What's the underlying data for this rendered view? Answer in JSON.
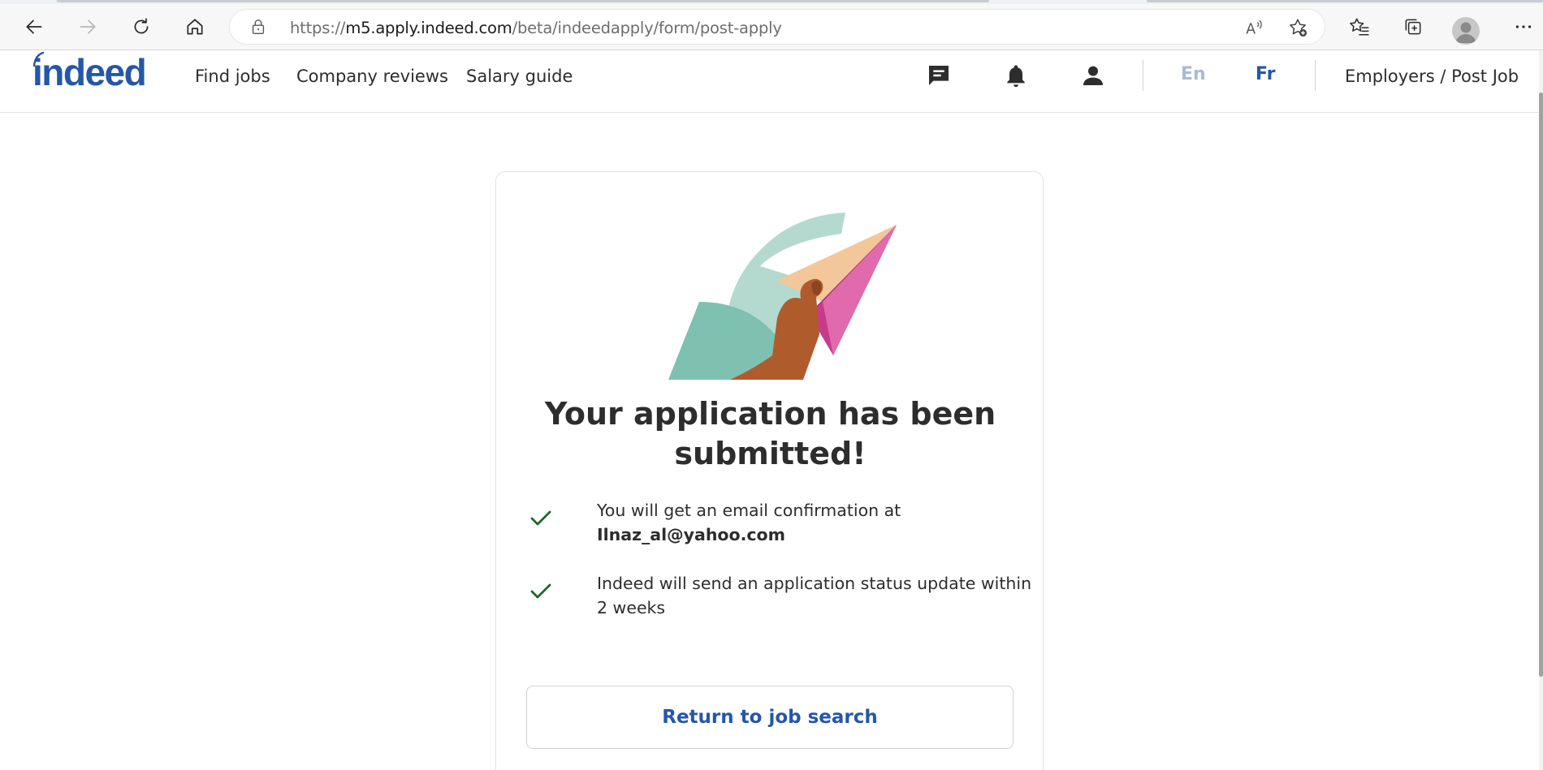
{
  "browser": {
    "url_scheme": "https://",
    "url_host": "m5.apply.indeed.com",
    "url_path": "/beta/indeedapply/form/post-apply",
    "icons": [
      "back-icon",
      "forward-icon",
      "refresh-icon",
      "home-icon",
      "lock-icon",
      "read-aloud-icon",
      "add-favorite-icon",
      "favorites-icon",
      "collections-icon",
      "profile-icon",
      "more-icon"
    ]
  },
  "header": {
    "logo": "indeed",
    "nav": [
      "Find jobs",
      "Company reviews",
      "Salary guide"
    ],
    "icons": [
      "messages-icon",
      "notifications-icon",
      "account-icon"
    ],
    "lang_en": "En",
    "lang_fr": "Fr",
    "employers": "Employers / Post Job",
    "colors": {
      "brand": "#2557a7",
      "lang_inactive": "#a7bbd8"
    }
  },
  "main": {
    "headline": "Your application has been submitted!",
    "items": [
      {
        "text": "You will get an email confirmation at",
        "bold": "Ilnaz_al@yahoo.com"
      },
      {
        "text": "Indeed will send an application status update within 2 weeks",
        "bold": ""
      }
    ],
    "check_color": "#1f662c",
    "return_button": "Return to job search"
  }
}
